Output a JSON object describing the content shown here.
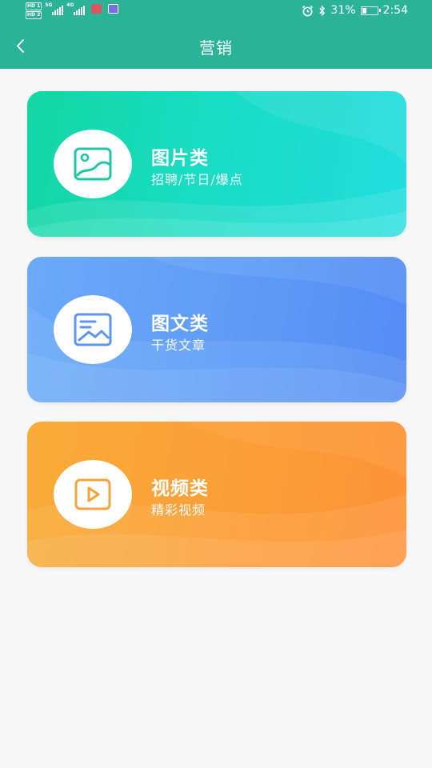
{
  "status_bar": {
    "hd1": "HD 1",
    "hd2": "HD 2",
    "net1": "5G",
    "net2": "4G",
    "battery_percent": "31%",
    "battery_level": 0.31,
    "time": "2:54",
    "icons": [
      "alarm-icon",
      "bluetooth-icon",
      "battery-icon"
    ]
  },
  "nav": {
    "title": "营销",
    "back_icon": "chevron-left-icon"
  },
  "cards": [
    {
      "title": "图片类",
      "subtitle": "招聘/节日/爆点",
      "icon": "image-icon",
      "accent": "#1fc7a4"
    },
    {
      "title": "图文类",
      "subtitle": "干货文章",
      "icon": "article-image-icon",
      "accent": "#5b95f0"
    },
    {
      "title": "视频类",
      "subtitle": "精彩视频",
      "icon": "video-play-icon",
      "accent": "#f7a23a"
    }
  ]
}
